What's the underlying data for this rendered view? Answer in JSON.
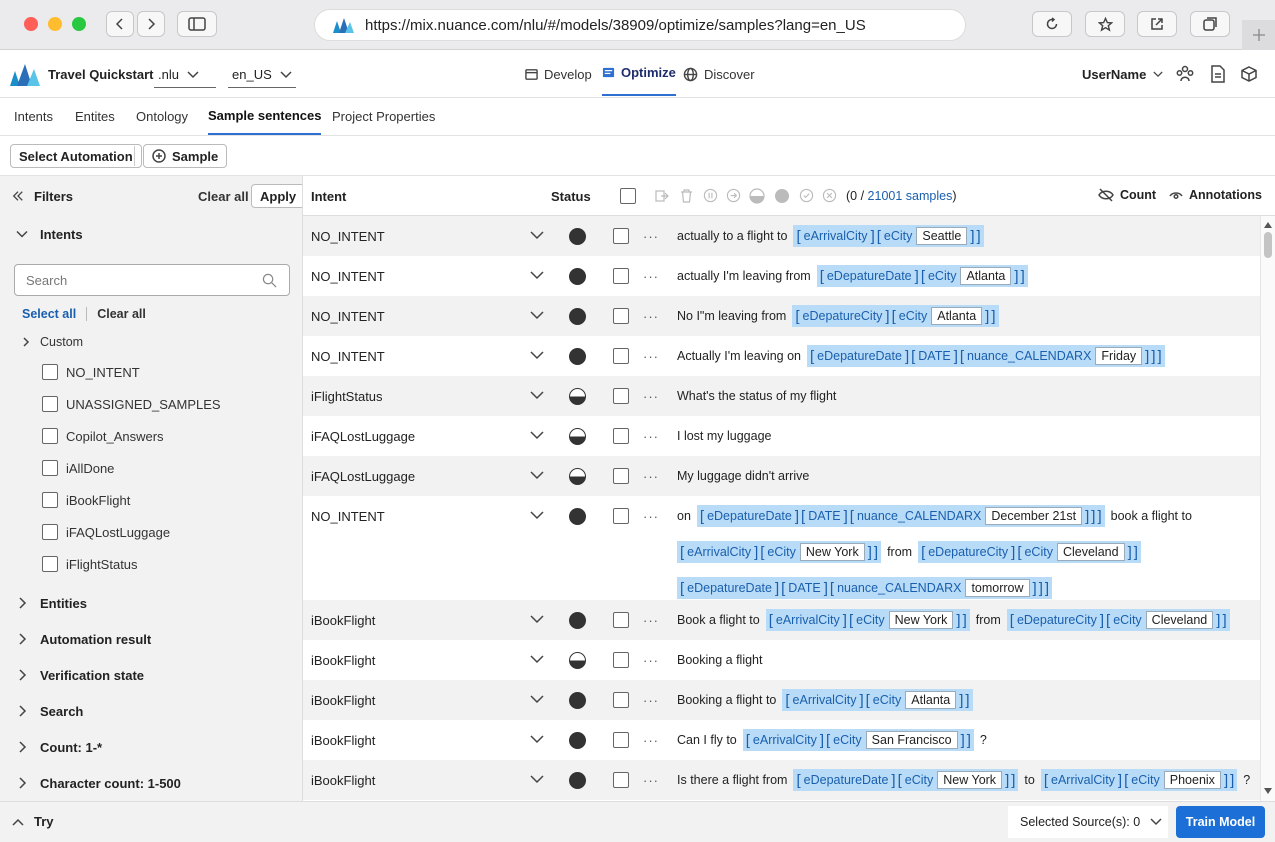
{
  "browser": {
    "url": "https://mix.nuance.com/nlu/#/models/38909/optimize/samples?lang=en_US"
  },
  "app": {
    "project": "Travel Quickstart",
    "model_select": ".nlu",
    "lang_select": "en_US",
    "nav": [
      {
        "label": "Develop"
      },
      {
        "label": "Optimize"
      },
      {
        "label": "Discover"
      }
    ],
    "user": "UserName"
  },
  "tabs": [
    {
      "label": "Intents"
    },
    {
      "label": "Entites"
    },
    {
      "label": "Ontology"
    },
    {
      "label": "Sample sentences"
    },
    {
      "label": "Project Properties"
    }
  ],
  "toolbar": {
    "select_automation": "Select Automation",
    "sample": "Sample"
  },
  "filters": {
    "title": "Filters",
    "clear_all": "Clear all",
    "apply": "Apply",
    "intents_label": "Intents",
    "search_placeholder": "Search",
    "select_all": "Select all",
    "clear_all_small": "Clear all",
    "custom": "Custom",
    "intent_options": [
      "NO_INTENT",
      "UNASSIGNED_SAMPLES",
      "Copilot_Answers",
      "iAllDone",
      "iBookFlight",
      "iFAQLostLuggage",
      "iFlightStatus"
    ],
    "sections": [
      "Entities",
      "Automation result",
      "Verification state",
      "Search",
      "Count: 1-*",
      "Character count: 1-500"
    ]
  },
  "table": {
    "col_intent": "Intent",
    "col_status": "Status",
    "sel_prefix": "(0 / ",
    "sel_count": "21001 samples",
    "sel_suffix": ")",
    "count_label": "Count",
    "annotations_label": "Annotations"
  },
  "rows": [
    {
      "intent": "NO_INTENT",
      "status": "full",
      "lines": [
        [
          {
            "t": "actually to a flight to"
          },
          {
            "a": [
              "eArrivalCity",
              "eCity"
            ],
            "v": "Seattle"
          }
        ]
      ]
    },
    {
      "intent": "NO_INTENT",
      "status": "full",
      "lines": [
        [
          {
            "t": "actually I'm leaving from"
          },
          {
            "a": [
              "eDepatureDate",
              "eCity"
            ],
            "v": "Atlanta"
          }
        ]
      ]
    },
    {
      "intent": "NO_INTENT",
      "status": "full",
      "lines": [
        [
          {
            "t": "No I\"m leaving from"
          },
          {
            "a": [
              "eDepatureCity",
              "eCity"
            ],
            "v": "Atlanta"
          }
        ]
      ]
    },
    {
      "intent": "NO_INTENT",
      "status": "full",
      "lines": [
        [
          {
            "t": "Actually I'm leaving on"
          },
          {
            "a": [
              "eDepatureDate",
              "DATE",
              "nuance_CALENDARX"
            ],
            "v": "Friday"
          }
        ]
      ]
    },
    {
      "intent": "iFlightStatus",
      "status": "half",
      "lines": [
        [
          {
            "t": "What's the status of my flight"
          }
        ]
      ]
    },
    {
      "intent": "iFAQLostLuggage",
      "status": "half",
      "lines": [
        [
          {
            "t": "I lost my luggage"
          }
        ]
      ]
    },
    {
      "intent": "iFAQLostLuggage",
      "status": "half",
      "lines": [
        [
          {
            "t": "My luggage didn't arrive"
          }
        ]
      ]
    },
    {
      "intent": "NO_INTENT",
      "status": "full",
      "lines": [
        [
          {
            "t": "on"
          },
          {
            "a": [
              "eDepatureDate",
              "DATE",
              "nuance_CALENDARX"
            ],
            "v": "December 21st"
          },
          {
            "t": "book a flight to"
          }
        ],
        [
          {
            "a": [
              "eArrivalCity",
              "eCity"
            ],
            "v": "New York"
          },
          {
            "t": "from"
          },
          {
            "a": [
              "eDepatureCity",
              "eCity"
            ],
            "v": "Cleveland"
          }
        ],
        [
          {
            "a": [
              "eDepatureDate",
              "DATE",
              "nuance_CALENDARX"
            ],
            "v": "tomorrow"
          }
        ]
      ]
    },
    {
      "intent": "iBookFlight",
      "status": "full",
      "lines": [
        [
          {
            "t": "Book a flight to"
          },
          {
            "a": [
              "eArrivalCity",
              "eCity"
            ],
            "v": "New York"
          },
          {
            "t": "from"
          },
          {
            "a": [
              "eDepatureCity",
              "eCity"
            ],
            "v": "Cleveland"
          }
        ]
      ]
    },
    {
      "intent": "iBookFlight",
      "status": "half",
      "lines": [
        [
          {
            "t": "Booking a flight"
          }
        ]
      ]
    },
    {
      "intent": "iBookFlight",
      "status": "full",
      "lines": [
        [
          {
            "t": "Booking a flight to"
          },
          {
            "a": [
              "eArrivalCity",
              "eCity"
            ],
            "v": "Atlanta"
          }
        ]
      ]
    },
    {
      "intent": "iBookFlight",
      "status": "full",
      "lines": [
        [
          {
            "t": "Can I fly to"
          },
          {
            "a": [
              "eArrivalCity",
              "eCity"
            ],
            "v": "San Francisco"
          },
          {
            "t": "?"
          }
        ]
      ]
    },
    {
      "intent": "iBookFlight",
      "status": "full",
      "lines": [
        [
          {
            "t": "Is there a flight from"
          },
          {
            "a": [
              "eDepatureDate",
              "eCity"
            ],
            "v": "New York"
          },
          {
            "t": "to"
          },
          {
            "a": [
              "eArrivalCity",
              "eCity"
            ],
            "v": "Phoenix"
          },
          {
            "t": "?"
          }
        ]
      ]
    }
  ],
  "bottom": {
    "try": "Try",
    "sources": "Selected Source(s): 0",
    "train": "Train Model"
  }
}
